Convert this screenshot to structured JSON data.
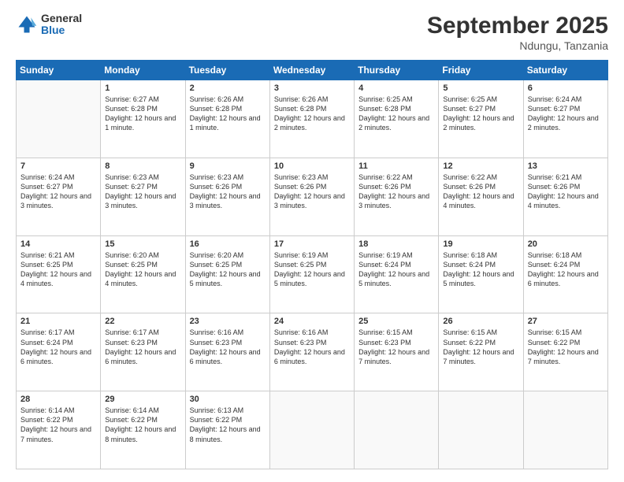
{
  "logo": {
    "general": "General",
    "blue": "Blue"
  },
  "header": {
    "title": "September 2025",
    "location": "Ndungu, Tanzania"
  },
  "weekdays": [
    "Sunday",
    "Monday",
    "Tuesday",
    "Wednesday",
    "Thursday",
    "Friday",
    "Saturday"
  ],
  "weeks": [
    [
      {
        "day": "",
        "sunrise": "",
        "sunset": "",
        "daylight": ""
      },
      {
        "day": "1",
        "sunrise": "Sunrise: 6:27 AM",
        "sunset": "Sunset: 6:28 PM",
        "daylight": "Daylight: 12 hours and 1 minute."
      },
      {
        "day": "2",
        "sunrise": "Sunrise: 6:26 AM",
        "sunset": "Sunset: 6:28 PM",
        "daylight": "Daylight: 12 hours and 1 minute."
      },
      {
        "day": "3",
        "sunrise": "Sunrise: 6:26 AM",
        "sunset": "Sunset: 6:28 PM",
        "daylight": "Daylight: 12 hours and 2 minutes."
      },
      {
        "day": "4",
        "sunrise": "Sunrise: 6:25 AM",
        "sunset": "Sunset: 6:28 PM",
        "daylight": "Daylight: 12 hours and 2 minutes."
      },
      {
        "day": "5",
        "sunrise": "Sunrise: 6:25 AM",
        "sunset": "Sunset: 6:27 PM",
        "daylight": "Daylight: 12 hours and 2 minutes."
      },
      {
        "day": "6",
        "sunrise": "Sunrise: 6:24 AM",
        "sunset": "Sunset: 6:27 PM",
        "daylight": "Daylight: 12 hours and 2 minutes."
      }
    ],
    [
      {
        "day": "7",
        "sunrise": "Sunrise: 6:24 AM",
        "sunset": "Sunset: 6:27 PM",
        "daylight": "Daylight: 12 hours and 3 minutes."
      },
      {
        "day": "8",
        "sunrise": "Sunrise: 6:23 AM",
        "sunset": "Sunset: 6:27 PM",
        "daylight": "Daylight: 12 hours and 3 minutes."
      },
      {
        "day": "9",
        "sunrise": "Sunrise: 6:23 AM",
        "sunset": "Sunset: 6:26 PM",
        "daylight": "Daylight: 12 hours and 3 minutes."
      },
      {
        "day": "10",
        "sunrise": "Sunrise: 6:23 AM",
        "sunset": "Sunset: 6:26 PM",
        "daylight": "Daylight: 12 hours and 3 minutes."
      },
      {
        "day": "11",
        "sunrise": "Sunrise: 6:22 AM",
        "sunset": "Sunset: 6:26 PM",
        "daylight": "Daylight: 12 hours and 3 minutes."
      },
      {
        "day": "12",
        "sunrise": "Sunrise: 6:22 AM",
        "sunset": "Sunset: 6:26 PM",
        "daylight": "Daylight: 12 hours and 4 minutes."
      },
      {
        "day": "13",
        "sunrise": "Sunrise: 6:21 AM",
        "sunset": "Sunset: 6:26 PM",
        "daylight": "Daylight: 12 hours and 4 minutes."
      }
    ],
    [
      {
        "day": "14",
        "sunrise": "Sunrise: 6:21 AM",
        "sunset": "Sunset: 6:25 PM",
        "daylight": "Daylight: 12 hours and 4 minutes."
      },
      {
        "day": "15",
        "sunrise": "Sunrise: 6:20 AM",
        "sunset": "Sunset: 6:25 PM",
        "daylight": "Daylight: 12 hours and 4 minutes."
      },
      {
        "day": "16",
        "sunrise": "Sunrise: 6:20 AM",
        "sunset": "Sunset: 6:25 PM",
        "daylight": "Daylight: 12 hours and 5 minutes."
      },
      {
        "day": "17",
        "sunrise": "Sunrise: 6:19 AM",
        "sunset": "Sunset: 6:25 PM",
        "daylight": "Daylight: 12 hours and 5 minutes."
      },
      {
        "day": "18",
        "sunrise": "Sunrise: 6:19 AM",
        "sunset": "Sunset: 6:24 PM",
        "daylight": "Daylight: 12 hours and 5 minutes."
      },
      {
        "day": "19",
        "sunrise": "Sunrise: 6:18 AM",
        "sunset": "Sunset: 6:24 PM",
        "daylight": "Daylight: 12 hours and 5 minutes."
      },
      {
        "day": "20",
        "sunrise": "Sunrise: 6:18 AM",
        "sunset": "Sunset: 6:24 PM",
        "daylight": "Daylight: 12 hours and 6 minutes."
      }
    ],
    [
      {
        "day": "21",
        "sunrise": "Sunrise: 6:17 AM",
        "sunset": "Sunset: 6:24 PM",
        "daylight": "Daylight: 12 hours and 6 minutes."
      },
      {
        "day": "22",
        "sunrise": "Sunrise: 6:17 AM",
        "sunset": "Sunset: 6:23 PM",
        "daylight": "Daylight: 12 hours and 6 minutes."
      },
      {
        "day": "23",
        "sunrise": "Sunrise: 6:16 AM",
        "sunset": "Sunset: 6:23 PM",
        "daylight": "Daylight: 12 hours and 6 minutes."
      },
      {
        "day": "24",
        "sunrise": "Sunrise: 6:16 AM",
        "sunset": "Sunset: 6:23 PM",
        "daylight": "Daylight: 12 hours and 6 minutes."
      },
      {
        "day": "25",
        "sunrise": "Sunrise: 6:15 AM",
        "sunset": "Sunset: 6:23 PM",
        "daylight": "Daylight: 12 hours and 7 minutes."
      },
      {
        "day": "26",
        "sunrise": "Sunrise: 6:15 AM",
        "sunset": "Sunset: 6:22 PM",
        "daylight": "Daylight: 12 hours and 7 minutes."
      },
      {
        "day": "27",
        "sunrise": "Sunrise: 6:15 AM",
        "sunset": "Sunset: 6:22 PM",
        "daylight": "Daylight: 12 hours and 7 minutes."
      }
    ],
    [
      {
        "day": "28",
        "sunrise": "Sunrise: 6:14 AM",
        "sunset": "Sunset: 6:22 PM",
        "daylight": "Daylight: 12 hours and 7 minutes."
      },
      {
        "day": "29",
        "sunrise": "Sunrise: 6:14 AM",
        "sunset": "Sunset: 6:22 PM",
        "daylight": "Daylight: 12 hours and 8 minutes."
      },
      {
        "day": "30",
        "sunrise": "Sunrise: 6:13 AM",
        "sunset": "Sunset: 6:22 PM",
        "daylight": "Daylight: 12 hours and 8 minutes."
      },
      {
        "day": "",
        "sunrise": "",
        "sunset": "",
        "daylight": ""
      },
      {
        "day": "",
        "sunrise": "",
        "sunset": "",
        "daylight": ""
      },
      {
        "day": "",
        "sunrise": "",
        "sunset": "",
        "daylight": ""
      },
      {
        "day": "",
        "sunrise": "",
        "sunset": "",
        "daylight": ""
      }
    ]
  ]
}
